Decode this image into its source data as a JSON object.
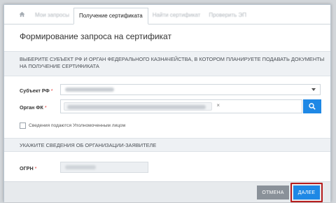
{
  "tabs": [
    {
      "label": "Мои запросы"
    },
    {
      "label": "Получение сертификата"
    },
    {
      "label": "Найти сертификат"
    },
    {
      "label": "Проверить ЭП"
    }
  ],
  "page_title": "Формирование запроса на сертификат",
  "section1": {
    "heading": "ВЫБЕРИТЕ СУБЪЕКТ РФ И ОРГАН ФЕДЕРАЛЬНОГО КАЗНАЧЕЙСТВА, В КОТОРОМ ПЛАНИРУЕТЕ ПОДАВАТЬ ДОКУМЕНТЫ НА ПОЛУЧЕНИЕ СЕРТИФИКАТА"
  },
  "fields": {
    "subject_label": "Субъект РФ",
    "organ_label": "Орган ФК",
    "required_mark": "*",
    "checkbox_label": "Сведения подаются Уполномоченным лицом",
    "ogrn_label": "ОГРН"
  },
  "section2": {
    "heading": "УКАЖИТЕ СВЕДЕНИЯ ОБ ОРГАНИЗАЦИИ-ЗАЯВИТЕЛЕ"
  },
  "footer": {
    "cancel_label": "ОТМЕНА",
    "next_label": "ДАЛЕЕ"
  },
  "colors": {
    "accent": "#1e88e5",
    "highlight": "#b71c1c",
    "cancel": "#8a9199"
  },
  "icons": {
    "home": "home-icon",
    "search": "search-icon",
    "caret": "chevron-down-icon",
    "remove": "close-icon"
  }
}
